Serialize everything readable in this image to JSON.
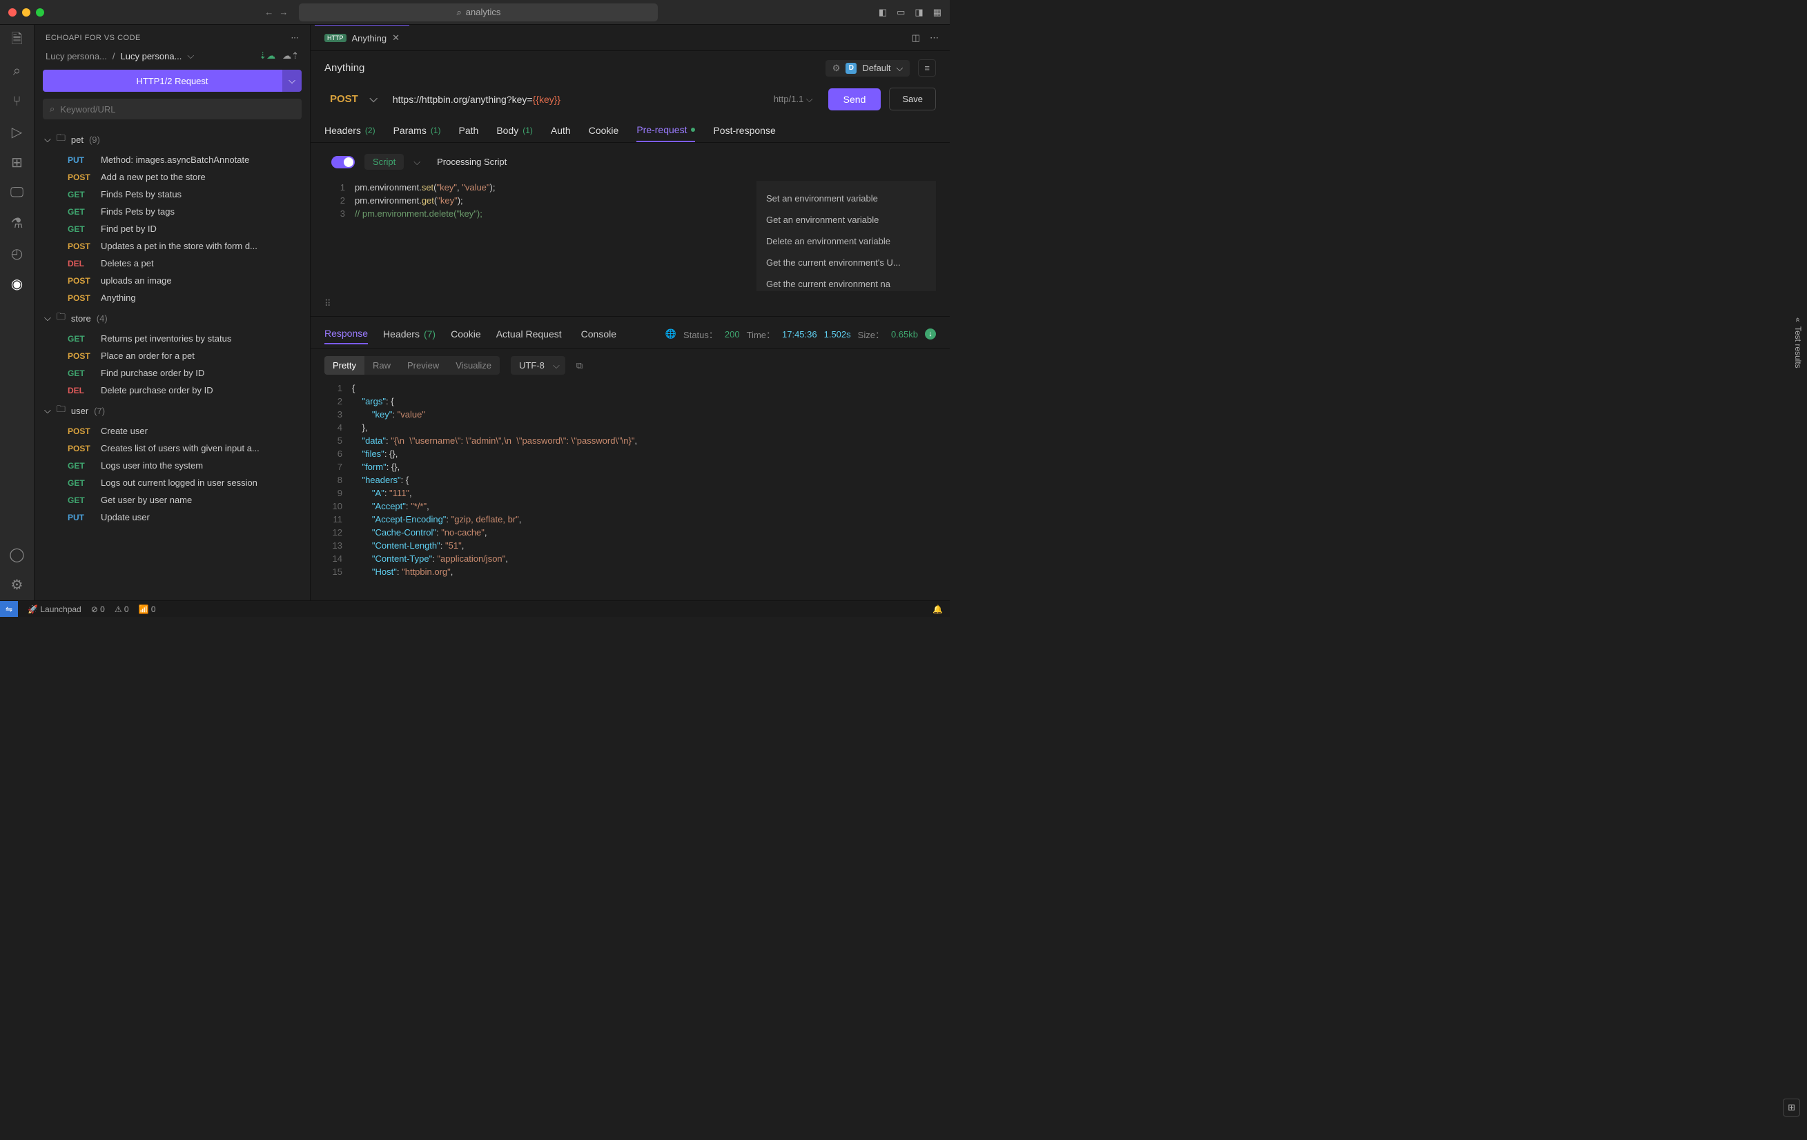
{
  "title_search": "analytics",
  "sidepanel": {
    "header": "ECHOAPI FOR VS CODE",
    "crumb1": "Lucy persona...",
    "crumb2": "Lucy persona...",
    "new_request": "HTTP1/2 Request",
    "search_placeholder": "Keyword/URL"
  },
  "tree": {
    "folders": [
      {
        "name": "pet",
        "count": "(9)",
        "items": [
          {
            "m": "PUT",
            "t": "Method: images.asyncBatchAnnotate"
          },
          {
            "m": "POST",
            "t": "Add a new pet to the store"
          },
          {
            "m": "GET",
            "t": "Finds Pets by status"
          },
          {
            "m": "GET",
            "t": "Finds Pets by tags"
          },
          {
            "m": "GET",
            "t": "Find pet by ID"
          },
          {
            "m": "POST",
            "t": "Updates a pet in the store with form d..."
          },
          {
            "m": "DEL",
            "t": "Deletes a pet"
          },
          {
            "m": "POST",
            "t": "uploads an image"
          },
          {
            "m": "POST",
            "t": "Anything"
          }
        ]
      },
      {
        "name": "store",
        "count": "(4)",
        "items": [
          {
            "m": "GET",
            "t": "Returns pet inventories by status"
          },
          {
            "m": "POST",
            "t": "Place an order for a pet"
          },
          {
            "m": "GET",
            "t": "Find purchase order by ID"
          },
          {
            "m": "DEL",
            "t": "Delete purchase order by ID"
          }
        ]
      },
      {
        "name": "user",
        "count": "(7)",
        "items": [
          {
            "m": "POST",
            "t": "Create user"
          },
          {
            "m": "POST",
            "t": "Creates list of users with given input a..."
          },
          {
            "m": "GET",
            "t": "Logs user into the system"
          },
          {
            "m": "GET",
            "t": "Logs out current logged in user session"
          },
          {
            "m": "GET",
            "t": "Get user by user name"
          },
          {
            "m": "PUT",
            "t": "Update user"
          }
        ]
      }
    ]
  },
  "tab": {
    "label": "Anything"
  },
  "request": {
    "title": "Anything",
    "env": "Default",
    "method": "POST",
    "url_pre": "https://httpbin.org/anything?key=",
    "url_var": "{{key}}",
    "proto": "http/1.1",
    "send": "Send",
    "save": "Save"
  },
  "reqtabs": {
    "headers": "Headers",
    "headers_n": "(2)",
    "params": "Params",
    "params_n": "(1)",
    "path": "Path",
    "body": "Body",
    "body_n": "(1)",
    "auth": "Auth",
    "cookie": "Cookie",
    "prereq": "Pre-request",
    "postresp": "Post-response"
  },
  "script": {
    "label": "Script",
    "proc": "Processing Script",
    "lines": [
      {
        "n": "1",
        "html": "pm.environment.<span class='tok-fn'>set</span>(<span class='tok-s'>\"key\"</span>, <span class='tok-s'>\"value\"</span>);"
      },
      {
        "n": "2",
        "html": "pm.environment.<span class='tok-fn'>get</span>(<span class='tok-s'>\"key\"</span>);"
      },
      {
        "n": "3",
        "html": "<span class='tok-c'>// pm.environment.delete(\"key\");</span>"
      }
    ]
  },
  "snippets": [
    "Set an environment variable",
    "Get an environment variable",
    "Delete an environment variable",
    "Get the current environment's U...",
    "Get the current environment na"
  ],
  "resp": {
    "tabs": {
      "response": "Response",
      "headers": "Headers",
      "headers_n": "(7)",
      "cookie": "Cookie",
      "actual": "Actual Request",
      "console": "Console"
    },
    "status_lbl": "Status：",
    "status": "200",
    "time_lbl": "Time：",
    "time": "17:45:36",
    "dur": "1.502s",
    "size_lbl": "Size：",
    "size": "0.65kb",
    "view": {
      "pretty": "Pretty",
      "raw": "Raw",
      "preview": "Preview",
      "visualize": "Visualize"
    },
    "encoding": "UTF-8"
  },
  "json_lines": [
    {
      "n": "1",
      "h": "<span class='j-p'>{</span>"
    },
    {
      "n": "2",
      "h": "&nbsp;&nbsp;&nbsp;&nbsp;<span class='j-k'>\"args\"</span><span class='j-p'>: {</span>"
    },
    {
      "n": "3",
      "h": "&nbsp;&nbsp;&nbsp;&nbsp;&nbsp;&nbsp;&nbsp;&nbsp;<span class='j-k'>\"key\"</span><span class='j-p'>: </span><span class='j-s'>\"value\"</span>"
    },
    {
      "n": "4",
      "h": "&nbsp;&nbsp;&nbsp;&nbsp;<span class='j-p'>},</span>"
    },
    {
      "n": "5",
      "h": "&nbsp;&nbsp;&nbsp;&nbsp;<span class='j-k'>\"data\"</span><span class='j-p'>: </span><span class='j-s'>\"{\\n&nbsp;&nbsp;\\\"username\\\": \\\"admin\\\",\\n&nbsp;&nbsp;\\\"password\\\": \\\"password\\\"\\n}\"</span><span class='j-p'>,</span>"
    },
    {
      "n": "6",
      "h": "&nbsp;&nbsp;&nbsp;&nbsp;<span class='j-k'>\"files\"</span><span class='j-p'>: {},</span>"
    },
    {
      "n": "7",
      "h": "&nbsp;&nbsp;&nbsp;&nbsp;<span class='j-k'>\"form\"</span><span class='j-p'>: {},</span>"
    },
    {
      "n": "8",
      "h": "&nbsp;&nbsp;&nbsp;&nbsp;<span class='j-k'>\"headers\"</span><span class='j-p'>: {</span>"
    },
    {
      "n": "9",
      "h": "&nbsp;&nbsp;&nbsp;&nbsp;&nbsp;&nbsp;&nbsp;&nbsp;<span class='j-k'>\"A\"</span><span class='j-p'>: </span><span class='j-s'>\"111\"</span><span class='j-p'>,</span>"
    },
    {
      "n": "10",
      "h": "&nbsp;&nbsp;&nbsp;&nbsp;&nbsp;&nbsp;&nbsp;&nbsp;<span class='j-k'>\"Accept\"</span><span class='j-p'>: </span><span class='j-s'>\"*/*\"</span><span class='j-p'>,</span>"
    },
    {
      "n": "11",
      "h": "&nbsp;&nbsp;&nbsp;&nbsp;&nbsp;&nbsp;&nbsp;&nbsp;<span class='j-k'>\"Accept-Encoding\"</span><span class='j-p'>: </span><span class='j-s'>\"gzip, deflate, br\"</span><span class='j-p'>,</span>"
    },
    {
      "n": "12",
      "h": "&nbsp;&nbsp;&nbsp;&nbsp;&nbsp;&nbsp;&nbsp;&nbsp;<span class='j-k'>\"Cache-Control\"</span><span class='j-p'>: </span><span class='j-s'>\"no-cache\"</span><span class='j-p'>,</span>"
    },
    {
      "n": "13",
      "h": "&nbsp;&nbsp;&nbsp;&nbsp;&nbsp;&nbsp;&nbsp;&nbsp;<span class='j-k'>\"Content-Length\"</span><span class='j-p'>: </span><span class='j-s'>\"51\"</span><span class='j-p'>,</span>"
    },
    {
      "n": "14",
      "h": "&nbsp;&nbsp;&nbsp;&nbsp;&nbsp;&nbsp;&nbsp;&nbsp;<span class='j-k'>\"Content-Type\"</span><span class='j-p'>: </span><span class='j-s'>\"application/json\"</span><span class='j-p'>,</span>"
    },
    {
      "n": "15",
      "h": "&nbsp;&nbsp;&nbsp;&nbsp;&nbsp;&nbsp;&nbsp;&nbsp;<span class='j-k'>\"Host\"</span><span class='j-p'>: </span><span class='j-s'>\"httpbin.org\"</span><span class='j-p'>,</span>"
    }
  ],
  "rightgutter": "Test results",
  "statusbar": {
    "launchpad": "Launchpad",
    "err": "0",
    "warn": "0",
    "port": "0"
  }
}
